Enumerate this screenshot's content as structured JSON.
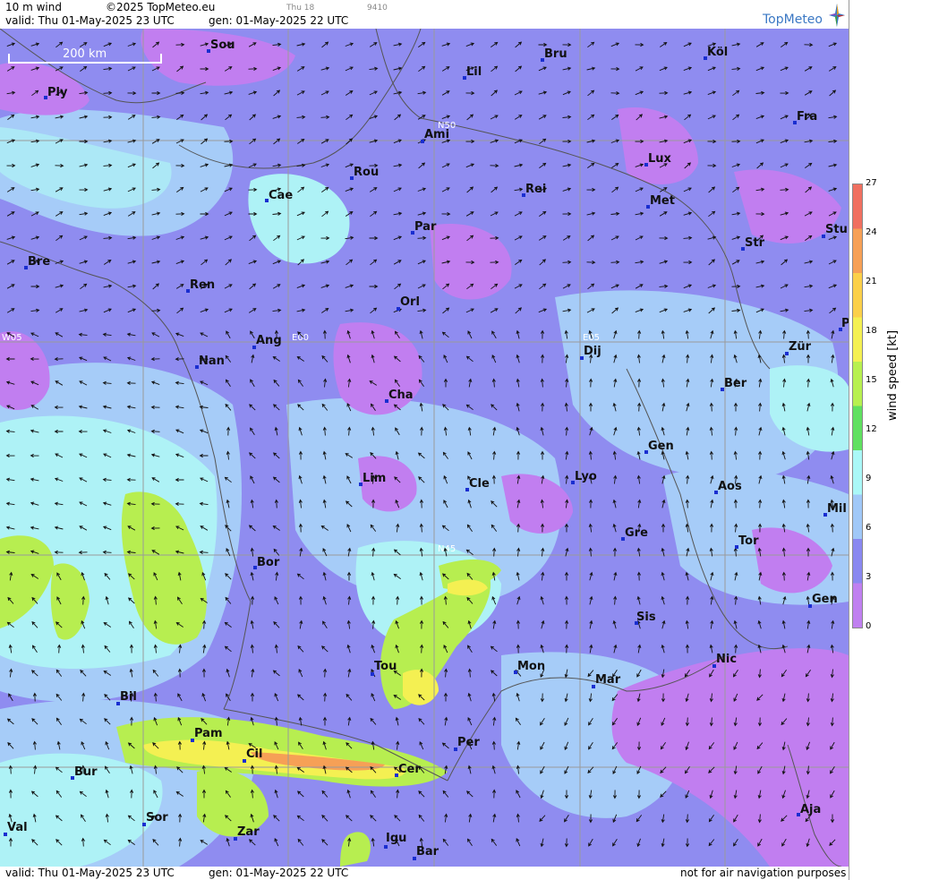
{
  "header": {
    "product": "10 m wind",
    "copyright": "©2025 TopMeteo.eu",
    "small_day": "Thu 18",
    "small_code": "9410",
    "valid": "valid:  Thu  01-May-2025  23 UTC",
    "gen": "gen:  01-May-2025 22 UTC",
    "logo": "TopMeteo"
  },
  "footer": {
    "valid": "valid:  Thu  01-May-2025  23 UTC",
    "gen": "gen:  01-May-2025 22 UTC",
    "disclaimer": "not for air navigation purposes"
  },
  "map": {
    "scale_label": "200 km",
    "grid_labels": [
      "N50",
      "N45",
      "W05",
      "E00",
      "E05"
    ],
    "cities": [
      "Sou",
      "Ply",
      "Lil",
      "Bru",
      "Köl",
      "Ami",
      "Fra",
      "Lux",
      "Rou",
      "Cae",
      "Rei",
      "Met",
      "Par",
      "Bre",
      "Str",
      "Stu",
      "Ren",
      "Orl",
      "Ang",
      "Nan",
      "Dij",
      "Zür",
      "Ber",
      "Cha",
      "Gen",
      "Lim",
      "Cle",
      "Lyo",
      "Aos",
      "Mil",
      "Gre",
      "Tor",
      "Bor",
      "Sis",
      "Gen",
      "Nic",
      "Tou",
      "Mon",
      "Mar",
      "Bil",
      "Pam",
      "Cil",
      "Per",
      "Cer",
      "Bur",
      "Sor",
      "Val",
      "Zar",
      "Igu",
      "Bar",
      "Aja",
      "P"
    ]
  },
  "legend": {
    "title": "wind speed [kt]",
    "ticks": [
      "27",
      "24",
      "21",
      "18",
      "15",
      "12",
      "9",
      "6",
      "3",
      "0"
    ],
    "colors": [
      "#f07060",
      "#f6a056",
      "#fbd04a",
      "#f4f052",
      "#b8f050",
      "#60e060",
      "#aaf8f8",
      "#a0c8f8",
      "#8a88f0",
      "#c080f0"
    ]
  }
}
